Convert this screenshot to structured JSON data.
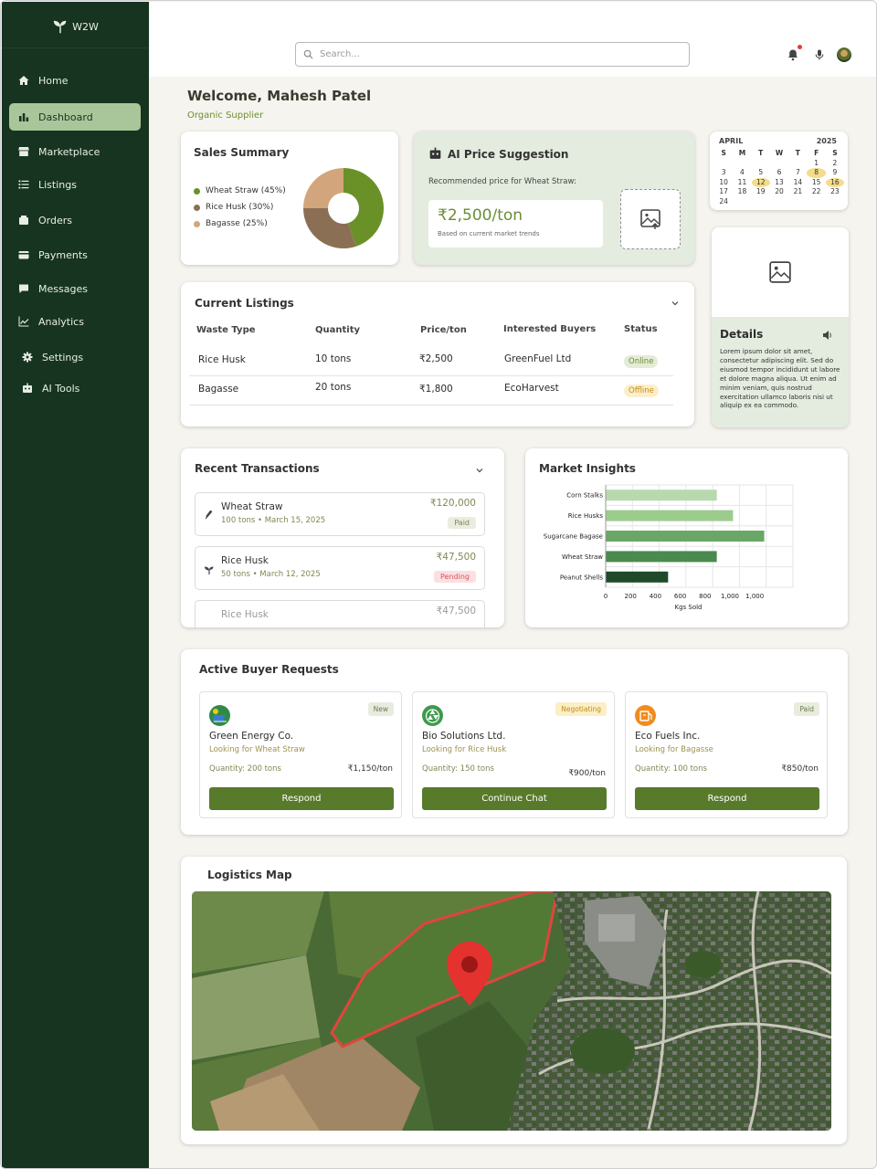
{
  "brand": {
    "name": "W2W"
  },
  "sidebar": {
    "items": [
      {
        "label": "Home",
        "icon": "home-icon"
      },
      {
        "label": "Dashboard",
        "icon": "bar-chart-icon",
        "active": true
      },
      {
        "label": "Marketplace",
        "icon": "store-icon"
      },
      {
        "label": "Listings",
        "icon": "list-icon"
      },
      {
        "label": "Orders",
        "icon": "package-icon"
      },
      {
        "label": "Payments",
        "icon": "wallet-icon"
      },
      {
        "label": "Messages",
        "icon": "chat-icon"
      },
      {
        "label": "Analytics",
        "icon": "trend-icon"
      },
      {
        "label": "Settings",
        "icon": "gear-icon"
      },
      {
        "label": "AI Tools",
        "icon": "robot-icon"
      }
    ]
  },
  "header": {
    "search_placeholder": "Search..."
  },
  "welcome": {
    "title": "Welcome, Mahesh Patel",
    "role": "Organic Supplier"
  },
  "sales_summary": {
    "title": "Sales Summary",
    "legend": [
      "Wheat Straw (45%)",
      "Rice Husk (30%)",
      "Bagasse (25%)"
    ],
    "chart_data": {
      "type": "pie",
      "categories": [
        "Wheat Straw",
        "Rice Husk",
        "Bagasse"
      ],
      "values": [
        45,
        30,
        25
      ],
      "colors": [
        "#6a9128",
        "#8b6f54",
        "#d2a57c"
      ]
    }
  },
  "ai_price": {
    "title": "AI Price Suggestion",
    "subtitle": "Recommended price for Wheat Straw:",
    "price": "₹2,500/ton",
    "note": "Based on current market trends"
  },
  "calendar": {
    "month": "APRIL",
    "year": "2025",
    "weekdays": [
      "S",
      "M",
      "T",
      "W",
      "T",
      "F",
      "S"
    ],
    "days": [
      "",
      "",
      "",
      "",
      "",
      "1",
      "2",
      "3",
      "4",
      "5",
      "6",
      "7",
      "8",
      "9",
      "10",
      "11",
      "12",
      "13",
      "14",
      "15",
      "16",
      "17",
      "18",
      "19",
      "20",
      "21",
      "22",
      "23",
      "24"
    ],
    "highlighted": [
      "8",
      "12",
      "16"
    ]
  },
  "details": {
    "title": "Details",
    "text": "Lorem ipsum dolor sit amet, consectetur adipiscing elit. Sed do eiusmod tempor incididunt ut labore et dolore magna aliqua. Ut enim ad minim veniam, quis nostrud exercitation ullamco laboris nisi ut aliquip ex ea commodo."
  },
  "listings": {
    "title": "Current Listings",
    "columns": [
      "Waste Type",
      "Quantity",
      "Price/ton",
      "Interested Buyers",
      "Status"
    ],
    "rows": [
      {
        "type": "Rice Husk",
        "qty": "10 tons",
        "price": "₹2,500",
        "buyer": "GreenFuel Ltd",
        "status": "Online"
      },
      {
        "type": "Bagasse",
        "qty": "20 tons",
        "price": "₹1,800",
        "buyer": "EcoHarvest",
        "status": "Offline"
      }
    ]
  },
  "transactions": {
    "title": "Recent Transactions",
    "items": [
      {
        "name": "Wheat Straw",
        "sub": "100 tons • March 15, 2025",
        "amount": "₹120,000",
        "status": "Paid"
      },
      {
        "name": "Rice Husk",
        "sub": "50 tons • March 12, 2025",
        "amount": "₹47,500",
        "status": "Pending"
      },
      {
        "name": "Rice Husk",
        "amount": "₹47,500"
      }
    ]
  },
  "market": {
    "title": "Market Insights",
    "chart_data": {
      "type": "bar",
      "orientation": "horizontal",
      "categories": [
        "Corn Stalks",
        "Rice Husks",
        "Sugarcane Bagase",
        "Wheat Straw",
        "Peanut Shells"
      ],
      "values": [
        890,
        1020,
        1270,
        890,
        500
      ],
      "colors": [
        "#b8d9ae",
        "#9ccb8e",
        "#6aa767",
        "#4a8a4e",
        "#1f4a2a"
      ],
      "xlabel": "Kgs Sold",
      "xticks": [
        "0",
        "200",
        "400",
        "600",
        "800",
        "1,000",
        "1,000"
      ],
      "xlim": [
        0,
        1500
      ],
      "grid": true
    }
  },
  "requests": {
    "title": "Active Buyer Requests",
    "items": [
      {
        "name": "Green Energy Co.",
        "looking": "Looking for Wheat Straw",
        "qty": "Quantity: 200 tons",
        "price": "₹1,150/ton",
        "badge": "New",
        "button": "Respond"
      },
      {
        "name": "Bio Solutions Ltd.",
        "looking": "Looking for Rice Husk",
        "qty": "Quantity: 150 tons",
        "price": "₹900/ton",
        "badge": "Negotiating",
        "button": "Continue Chat"
      },
      {
        "name": "Eco Fuels Inc.",
        "looking": "Looking for Bagasse",
        "qty": "Quantity: 100 tons",
        "price": "₹850/ton",
        "badge": "Paid",
        "button": "Respond"
      }
    ]
  },
  "logistics": {
    "title": "Logistics Map"
  }
}
